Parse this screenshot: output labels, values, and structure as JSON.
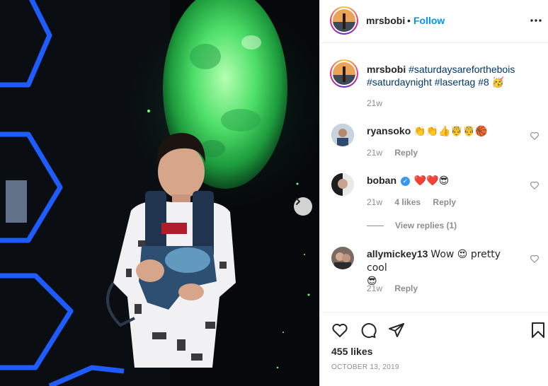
{
  "post": {
    "author": "mrsbobi",
    "follow_label": "Follow",
    "separator": "•",
    "caption": {
      "author": "mrsbobi",
      "hashtags": [
        "#saturdaysareforthebois",
        "#saturdaynight",
        "#lasertag",
        "#8"
      ],
      "emoji": "🥳",
      "time": "21w"
    },
    "comments": [
      {
        "user": "ryansoko",
        "text": "👏👏👍🤴🤴🏀",
        "time": "21w",
        "reply_label": "Reply",
        "avatar_color": "#6a7f9a"
      },
      {
        "user": "boban",
        "verified": true,
        "text": "❤️❤️😎",
        "time": "21w",
        "likes": "4 likes",
        "reply_label": "Reply",
        "avatar_color": "#3a3a3a",
        "view_replies": "View replies (1)"
      },
      {
        "user": "allymickey13",
        "text_line1": "Wow 😍 pretty cool",
        "text_line2": "😎",
        "time": "21w",
        "reply_label": "Reply",
        "avatar_color": "#5a4a44"
      }
    ],
    "likes": "455 likes",
    "date": "OCTOBER 13, 2019"
  },
  "colors": {
    "accent_blue": "#0095f6",
    "hashtag": "#00376b",
    "muted": "#8e8e8e",
    "neon_blue": "#1e6cff",
    "moon_green": "#3bd36a"
  },
  "icons": {
    "more": "ellipsis-icon",
    "heart": "heart-outline-icon",
    "comment": "comment-icon",
    "share": "paper-plane-icon",
    "save": "bookmark-icon",
    "next": "chevron-right-icon"
  }
}
